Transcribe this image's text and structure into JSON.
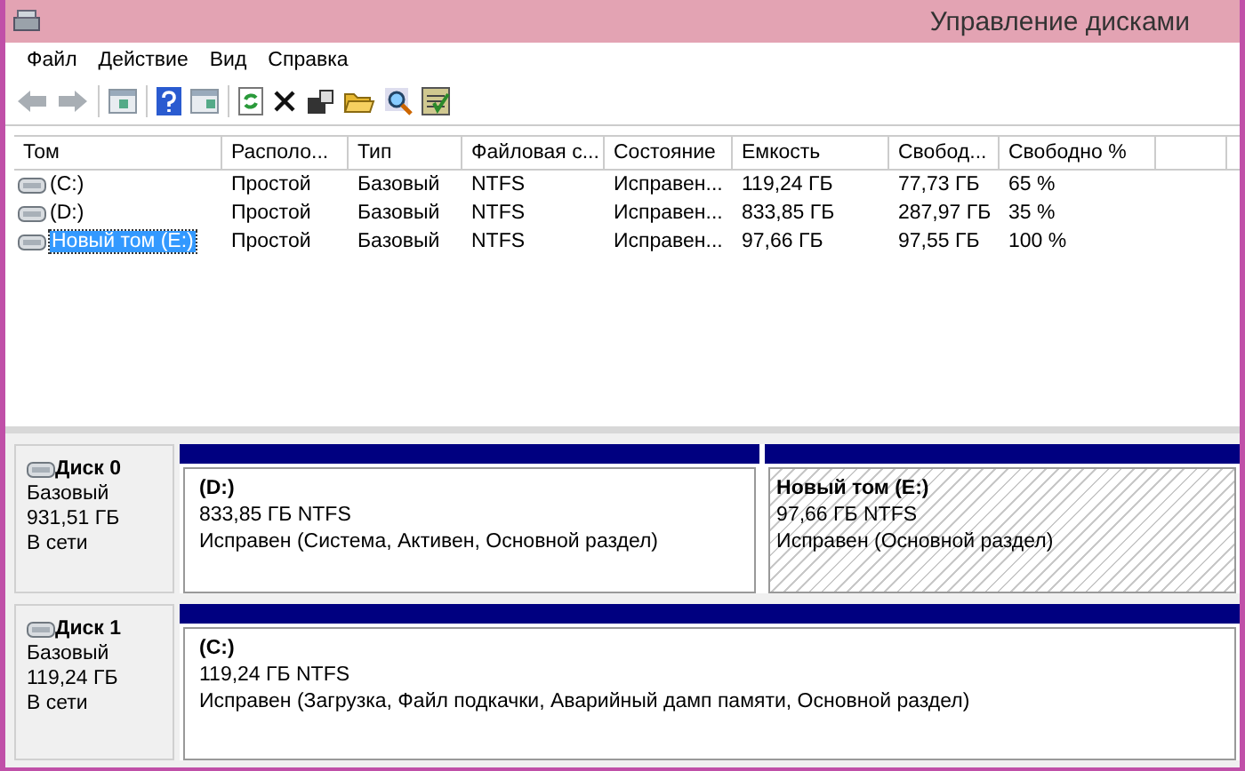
{
  "window": {
    "title": "Управление дисками"
  },
  "menu": [
    "Файл",
    "Действие",
    "Вид",
    "Справка"
  ],
  "table": {
    "columns": [
      "Том",
      "Располо...",
      "Тип",
      "Файловая с...",
      "Состояние",
      "Емкость",
      "Свобод...",
      "Свободно %"
    ],
    "rows": [
      {
        "cells": [
          "(C:)",
          "Простой",
          "Базовый",
          "NTFS",
          "Исправен...",
          "119,24 ГБ",
          "77,73 ГБ",
          "65 %"
        ],
        "selected": false
      },
      {
        "cells": [
          "(D:)",
          "Простой",
          "Базовый",
          "NTFS",
          "Исправен...",
          "833,85 ГБ",
          "287,97 ГБ",
          "35 %"
        ],
        "selected": false
      },
      {
        "cells": [
          "Новый том (E:)",
          "Простой",
          "Базовый",
          "NTFS",
          "Исправен...",
          "97,66 ГБ",
          "97,55 ГБ",
          "100 %"
        ],
        "selected": true
      }
    ]
  },
  "disks": [
    {
      "name": "Диск 0",
      "type": "Базовый",
      "size": "931,51 ГБ",
      "status": "В сети",
      "partitions": [
        {
          "name": "(D:)",
          "size": "833,85 ГБ NTFS",
          "status": "Исправен (Система, Активен, Основной раздел)",
          "selected": false
        },
        {
          "name": "Новый том (E:)",
          "size": "97,66 ГБ NTFS",
          "status": "Исправен (Основной раздел)",
          "selected": true
        }
      ]
    },
    {
      "name": "Диск 1",
      "type": "Базовый",
      "size": "119,24 ГБ",
      "status": "В сети",
      "partitions": [
        {
          "name": "(C:)",
          "size": "119,24 ГБ NTFS",
          "status": "Исправен (Загрузка, Файл подкачки, Аварийный дамп памяти, Основной раздел)",
          "selected": false
        }
      ]
    }
  ]
}
